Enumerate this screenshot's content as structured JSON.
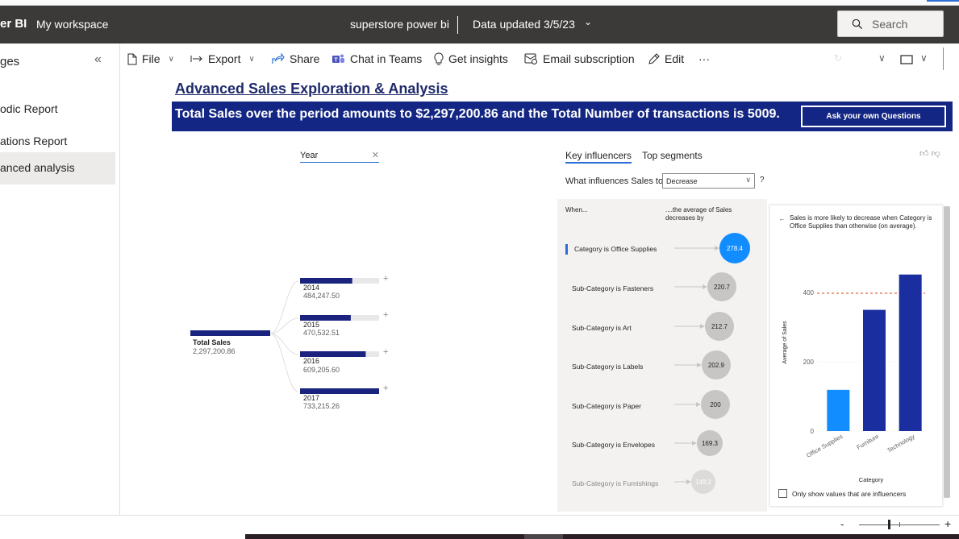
{
  "header": {
    "brand": "er BI",
    "workspace": "My workspace",
    "report_name": "superstore power bi",
    "data_updated": "Data updated 3/5/23",
    "search_placeholder": "Search"
  },
  "pages": {
    "title": "ges",
    "items": [
      {
        "label": "odic Report"
      },
      {
        "label": "ations Report"
      },
      {
        "label": "anced analysis",
        "active": true
      }
    ]
  },
  "toolbar": {
    "file": "File",
    "export": "Export",
    "share": "Share",
    "chat_in_teams": "Chat in Teams",
    "get_insights": "Get insights",
    "email_subscription": "Email subscription",
    "edit": "Edit",
    "more": "···"
  },
  "report": {
    "title": "Advanced Sales Exploration & Analysis",
    "banner": "Total Sales over the period amounts to $2,297,200.86 and the Total Number of transactions is  5009.",
    "ask_button": "Ask your own Questions"
  },
  "decomposition_tree": {
    "level_header": "Year",
    "root": {
      "label": "Total Sales",
      "value": "2,297,200.86"
    },
    "nodes": [
      {
        "label": "2014",
        "value": "484,247.50",
        "amount": 484247.5
      },
      {
        "label": "2015",
        "value": "470,532.51",
        "amount": 470532.51
      },
      {
        "label": "2016",
        "value": "609,205.60",
        "amount": 609205.6
      },
      {
        "label": "2017",
        "value": "733,215.26",
        "amount": 733215.26
      }
    ]
  },
  "key_influencers": {
    "tabs": [
      "Key influencers",
      "Top segments"
    ],
    "question": "What influences Sales to",
    "selected": "Decrease",
    "qmark": "?",
    "col_when": "When...",
    "col_avg": "....the average of Sales decreases by",
    "rows": [
      {
        "label": "Category is Office Supplies",
        "value": "278.4",
        "active": true
      },
      {
        "label": "Sub-Category is Fasteners",
        "value": "220.7"
      },
      {
        "label": "Sub-Category is Art",
        "value": "212.7"
      },
      {
        "label": "Sub-Category is Labels",
        "value": "202.9"
      },
      {
        "label": "Sub-Category is Paper",
        "value": "200"
      },
      {
        "label": "Sub-Category is Envelopes",
        "value": "169.3"
      },
      {
        "label": "Sub-Category is Furnishings",
        "value": "148.2",
        "muted": true
      }
    ],
    "detail_text": "Sales is more likely to decrease when Category is Office Supplies than otherwise (on average).",
    "show_influencers_only": "Only show values that are influencers",
    "colors": {
      "accent": "#118dff",
      "dark": "#1a2ea0",
      "bubble": "#c8c6c4",
      "reference": "#e8825f"
    }
  },
  "chart_data": {
    "type": "bar",
    "categories": [
      "Office Supplies",
      "Furniture",
      "Technology"
    ],
    "values": [
      119,
      350,
      452
    ],
    "highlight": "Office Supplies",
    "reference_line": 398,
    "xlabel": "Category",
    "ylabel": "Average of Sales",
    "yticks": [
      0,
      200,
      400
    ],
    "ylim": [
      0,
      470
    ]
  }
}
